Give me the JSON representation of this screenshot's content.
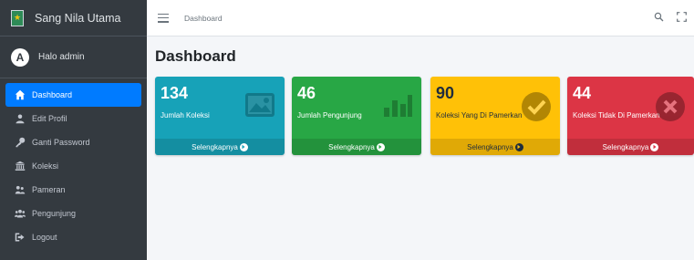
{
  "brand": {
    "name": "Sang Nila Utama"
  },
  "user": {
    "greeting": "Halo admin",
    "avatar_letter": "A"
  },
  "menu": [
    {
      "label": "Dashboard",
      "icon": "home-icon",
      "active": true
    },
    {
      "label": "Edit Profil",
      "icon": "user-edit-icon",
      "active": false
    },
    {
      "label": "Ganti Password",
      "icon": "key-icon",
      "active": false
    },
    {
      "label": "Koleksi",
      "icon": "museum-icon",
      "active": false
    },
    {
      "label": "Pameran",
      "icon": "exhibition-icon",
      "active": false
    },
    {
      "label": "Pengunjung",
      "icon": "users-icon",
      "active": false
    },
    {
      "label": "Logout",
      "icon": "logout-icon",
      "active": false
    }
  ],
  "topnav": {
    "breadcrumb": "Dashboard"
  },
  "page": {
    "title": "Dashboard"
  },
  "cards": [
    {
      "value": "134",
      "label": "Jumlah Koleksi",
      "link": "Selengkapnya",
      "color": "#17a2b8",
      "text_color": "#ffffff",
      "icon": "image-icon"
    },
    {
      "value": "46",
      "label": "Jumlah Pengunjung",
      "link": "Selengkapnya",
      "color": "#28a745",
      "text_color": "#ffffff",
      "icon": "bar-chart-icon"
    },
    {
      "value": "90",
      "label": "Koleksi Yang Di Pamerkan",
      "link": "Selengkapnya",
      "color": "#ffc107",
      "text_color": "#1f2d3d",
      "icon": "check-circle-icon"
    },
    {
      "value": "44",
      "label": "Koleksi Tidak Di Pamerkan",
      "link": "Selengkapnya",
      "color": "#dc3545",
      "text_color": "#ffffff",
      "icon": "times-circle-icon"
    }
  ]
}
